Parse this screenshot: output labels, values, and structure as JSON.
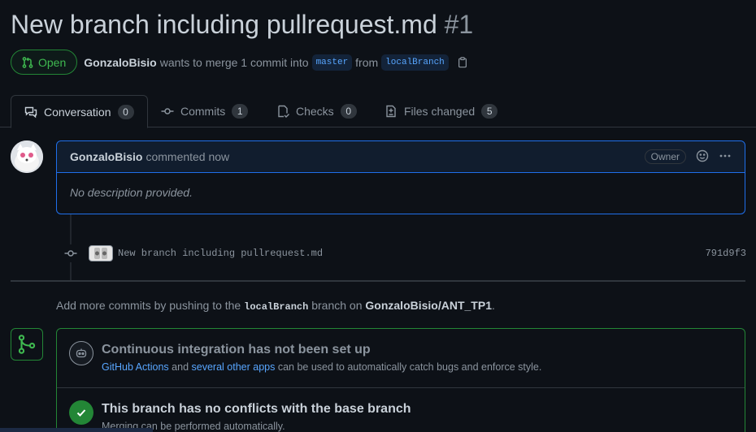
{
  "pr": {
    "title": "New branch including pullrequest.md",
    "number": "#1",
    "state": "Open",
    "author": "GonzaloBisio",
    "merge_text_1": "wants to merge 1 commit into",
    "base_branch": "master",
    "merge_text_2": "from",
    "head_branch": "localBranch"
  },
  "tabs": [
    {
      "label": "Conversation",
      "count": "0",
      "icon": "comment-discussion-icon"
    },
    {
      "label": "Commits",
      "count": "1",
      "icon": "git-commit-icon"
    },
    {
      "label": "Checks",
      "count": "0",
      "icon": "checklist-icon"
    },
    {
      "label": "Files changed",
      "count": "5",
      "icon": "file-diff-icon"
    }
  ],
  "comment": {
    "author": "GonzaloBisio",
    "time": "commented now",
    "role_badge": "Owner",
    "body": "No description provided."
  },
  "commit": {
    "message": "New branch including pullrequest.md",
    "sha": "791d9f3"
  },
  "hint": {
    "prefix": "Add more commits by pushing to the",
    "branch": "localBranch",
    "middle": "branch on",
    "repo": "GonzaloBisio/ANT_TP1",
    "suffix": "."
  },
  "merge": {
    "ci_title": "Continuous integration has not been set up",
    "ci_link_1": "GitHub Actions",
    "ci_text_1": "and",
    "ci_link_2": "several other apps",
    "ci_text_2": "can be used to automatically catch bugs and enforce style.",
    "conflict_title": "This branch has no conflicts with the base branch",
    "conflict_sub": "Merging can be performed automatically."
  },
  "colors": {
    "background": "#0d1117",
    "open_green": "#3fb950",
    "link_blue": "#58a6ff",
    "comment_border": "#1f6feb"
  }
}
